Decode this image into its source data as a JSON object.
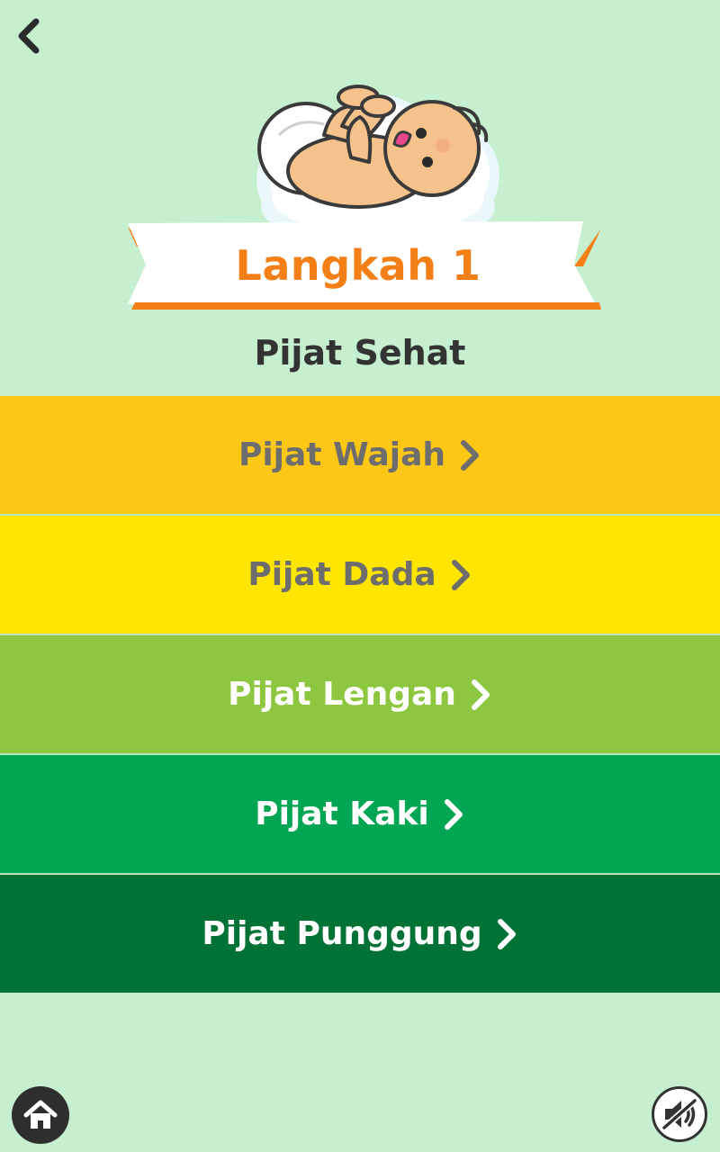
{
  "header": {
    "back_icon": "chevron-left-icon",
    "step_title": "Langkah 1",
    "subtitle": "Pijat Sehat"
  },
  "menu": {
    "items": [
      {
        "label": "Pijat Wajah",
        "bg": "#fdc716",
        "fg": "#6d6d6d"
      },
      {
        "label": "Pijat Dada",
        "bg": "#ffe500",
        "fg": "#6d6d6d"
      },
      {
        "label": "Pijat Lengan",
        "bg": "#8dc63f",
        "fg": "#ffffff"
      },
      {
        "label": "Pijat Kaki",
        "bg": "#00a651",
        "fg": "#ffffff"
      },
      {
        "label": "Pijat Punggung",
        "bg": "#007236",
        "fg": "#ffffff"
      }
    ]
  },
  "footer": {
    "home_icon": "home-icon",
    "sound_icon": "sound-muted-icon"
  },
  "colors": {
    "background": "#c5efcf",
    "accent_orange": "#f57f17",
    "dark": "#333333"
  }
}
